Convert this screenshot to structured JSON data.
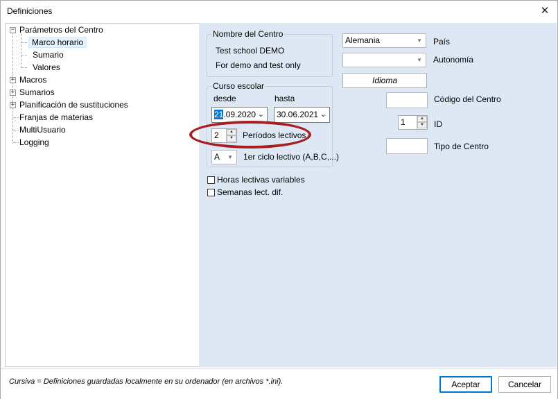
{
  "window": {
    "title": "Definiciones",
    "close_glyph": "✕"
  },
  "tree": {
    "items": [
      {
        "label": "Parámetros del Centro",
        "expander": "−"
      },
      {
        "label": "Marco horario"
      },
      {
        "label": "Sumario"
      },
      {
        "label": "Valores"
      },
      {
        "label": "Macros",
        "expander": "+"
      },
      {
        "label": "Sumarios",
        "expander": "+"
      },
      {
        "label": "Planificación de sustituciones",
        "expander": "+"
      },
      {
        "label": "Franjas de materias"
      },
      {
        "label": "MultiUsuario"
      },
      {
        "label": "Logging"
      }
    ]
  },
  "school": {
    "group_title": "Nombre del Centro",
    "name": "Test school  DEMO",
    "subtitle": "For demo and test only"
  },
  "year": {
    "group_title": "Curso escolar",
    "from_label": "desde",
    "to_label": "hasta",
    "from_day": "21",
    "from_rest": ".09.2020",
    "to_value": "30.06.2021",
    "periods_value": "2",
    "periods_label": "Períodos lectivos",
    "cycle_value": "A",
    "cycle_label": "1er ciclo lectivo (A,B,C,...)"
  },
  "options": {
    "variable_hours": "Horas lectivas variables",
    "weeks": "Semanas lect. dif."
  },
  "right": {
    "country_value": "Alemania",
    "country_label": "País",
    "autonomy_value": "",
    "autonomy_label": "Autonomía",
    "language_button": "Idioma",
    "code_label": "Código del Centro",
    "code_value": "",
    "id_value": "1",
    "id_label": "ID",
    "type_label": "Tipo de Centro",
    "type_value": ""
  },
  "footer": {
    "note": "Cursiva = Definiciones guardadas localmente en su ordenador (en archivos *.ini).",
    "accept": "Aceptar",
    "cancel": "Cancelar"
  },
  "colors": {
    "highlight": "#a61e22",
    "pane_bg": "#dde8f4",
    "selection": "#0078d7"
  }
}
